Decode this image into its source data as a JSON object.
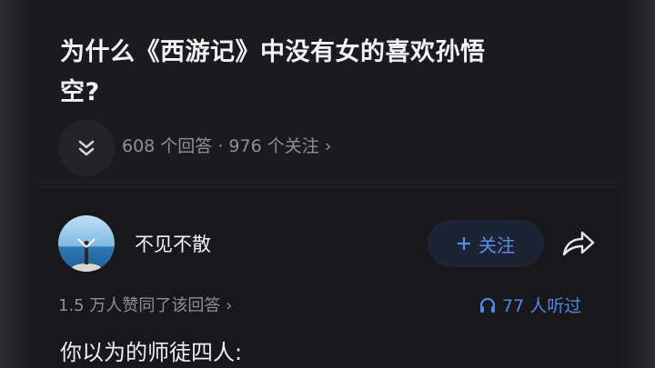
{
  "question": {
    "title_line1": "为什么《西游记》中没有女的喜欢孙悟",
    "title_line2": "空?",
    "meta": "608 个回答 · 976 个关注 ›"
  },
  "answer": {
    "author_name": "不见不散",
    "follow_label": "关注",
    "follow_icon": "plus-icon",
    "share_icon": "share-arrow-icon",
    "agree_text": "1.5 万人赞同了该回答 ›",
    "listen_icon": "headphones-icon",
    "listen_text": "77 人听过",
    "first_line": "你以为的师徒四人:"
  },
  "colors": {
    "background": "#18181b",
    "accent": "#4f86ec",
    "text_primary": "#f3f3f5",
    "text_secondary": "#8f9096"
  }
}
